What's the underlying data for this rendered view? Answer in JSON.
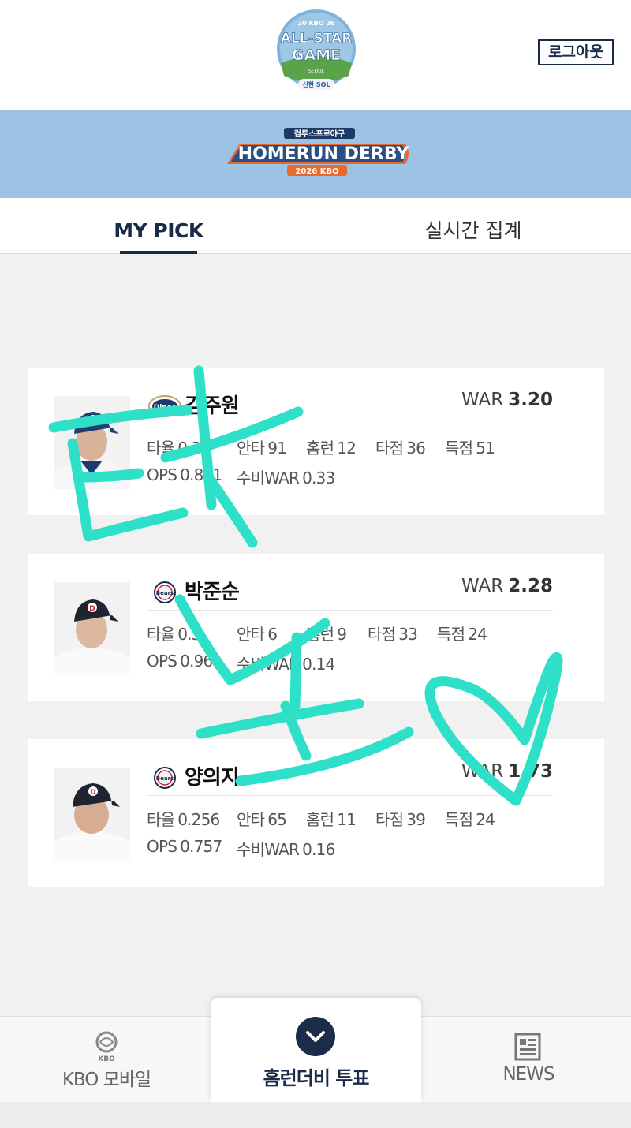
{
  "header": {
    "logo_icon": "allstar-game-logo",
    "logo_text": {
      "year_left": "20",
      "org": "KBO",
      "year_right": "26",
      "line1": "ALL-STAR",
      "line2": "GAME",
      "city": "SEOUL",
      "sponsor": "신한 SOL"
    },
    "logout_label": "로그아웃"
  },
  "banner": {
    "bg_color": "#9cc3e3",
    "logo_icon": "homerun-derby-logo",
    "logo_text": {
      "sponsor": "컴투스프로야구",
      "title": "HOMERUN DERBY",
      "sub": "2026 KBO"
    }
  },
  "tabs": [
    {
      "label": "MY PICK",
      "active": true
    },
    {
      "label": "실시간 집계",
      "active": false
    }
  ],
  "players": [
    {
      "name": "김주원",
      "team_icon": "nc-dinos-logo",
      "war_label": "WAR",
      "war": "3.20",
      "stats": [
        {
          "label": "타율",
          "value": "0.31"
        },
        {
          "label": "안타",
          "value": "91"
        },
        {
          "label": "홈런",
          "value": "12"
        },
        {
          "label": "타점",
          "value": "36"
        },
        {
          "label": "득점",
          "value": "51"
        },
        {
          "label": "OPS",
          "value": "0.871"
        },
        {
          "label": "수비WAR",
          "value": "0.33"
        }
      ]
    },
    {
      "name": "박준순",
      "team_icon": "doosan-bears-logo",
      "war_label": "WAR",
      "war": "2.28",
      "stats": [
        {
          "label": "타율",
          "value": "0.3"
        },
        {
          "label": "안타",
          "value": "6"
        },
        {
          "label": "홈런",
          "value": "9"
        },
        {
          "label": "타점",
          "value": "33"
        },
        {
          "label": "득점",
          "value": "24"
        },
        {
          "label": "OPS",
          "value": "0.96"
        },
        {
          "label": "수비WAR",
          "value": "0.14"
        }
      ]
    },
    {
      "name": "양의지",
      "team_icon": "doosan-bears-logo",
      "war_label": "WAR",
      "war": "1.73",
      "stats": [
        {
          "label": "타율",
          "value": "0.256"
        },
        {
          "label": "안타",
          "value": "65"
        },
        {
          "label": "홈런",
          "value": "11"
        },
        {
          "label": "타점",
          "value": "39"
        },
        {
          "label": "득점",
          "value": "24"
        },
        {
          "label": "OPS",
          "value": "0.757"
        },
        {
          "label": "수비WAR",
          "value": "0.16"
        }
      ]
    }
  ],
  "bottom_nav": {
    "kbo": {
      "label": "KBO 모바일",
      "icon": "kbo-logo-icon",
      "icon_text": "KBO"
    },
    "vote": {
      "label": "홈런더비 투표",
      "icon": "chevron-down-icon"
    },
    "news": {
      "label": "NEWS",
      "icon": "newspaper-icon"
    }
  },
  "overlay": {
    "type": "handwritten-scribble",
    "color": "#2fe0c8"
  },
  "colors": {
    "navy": "#1a2b49",
    "accent_teal": "#2fe0c8",
    "banner_blue": "#9cc3e3"
  }
}
